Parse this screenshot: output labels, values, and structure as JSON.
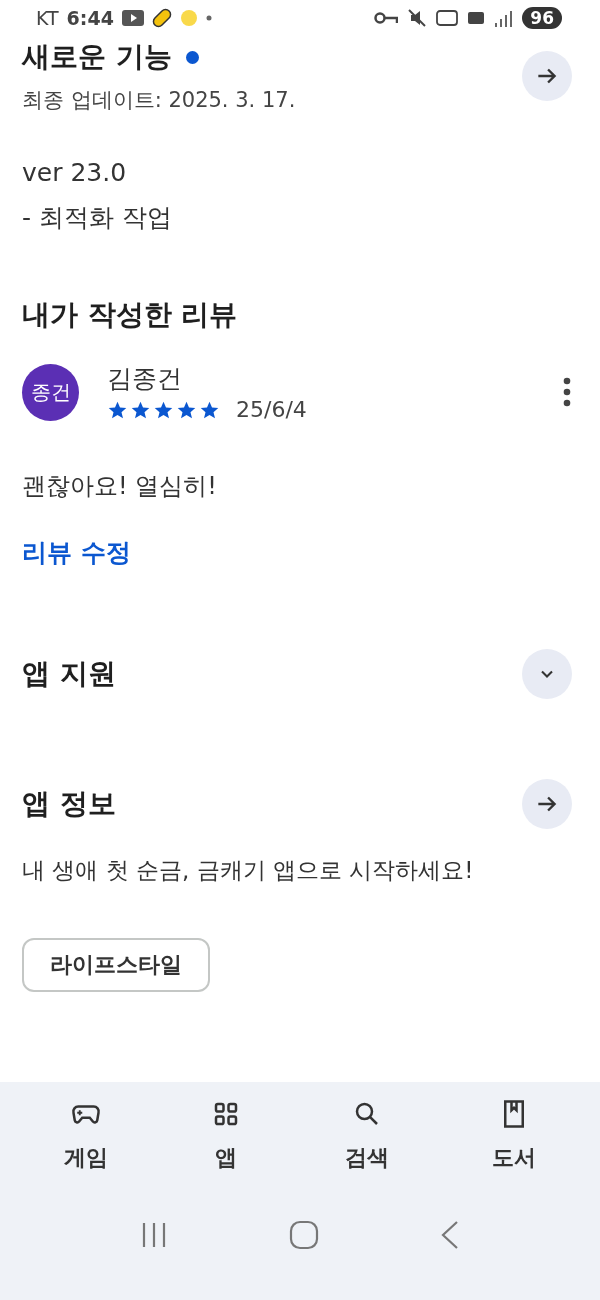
{
  "status_bar": {
    "carrier": "KT",
    "time": "6:44",
    "battery": "96"
  },
  "whats_new": {
    "title": "새로운 기능",
    "unread": true,
    "updated": "최종 업데이트: 2025. 3. 17.",
    "notes": [
      "ver 23.0",
      "- 최적화 작업"
    ]
  },
  "my_review": {
    "title": "내가 작성한 리뷰",
    "avatar": "종건",
    "author": "김종건",
    "stars": 5,
    "date": "25/6/4",
    "text": "괜찮아요! 열심히!",
    "edit_link": "리뷰 수정"
  },
  "app_support": {
    "title": "앱 지원",
    "expanded": false
  },
  "app_info": {
    "title": "앱 정보",
    "description": "내 생애 첫 순금, 금캐기 앱으로 시작하세요!",
    "category": "라이프스타일"
  },
  "bottom_nav": [
    {
      "kind": "games",
      "label": "게임",
      "selected": false
    },
    {
      "kind": "apps",
      "label": "앱",
      "selected": false
    },
    {
      "kind": "search",
      "label": "검색",
      "selected": false
    },
    {
      "kind": "books",
      "label": "도서",
      "selected": false
    }
  ]
}
